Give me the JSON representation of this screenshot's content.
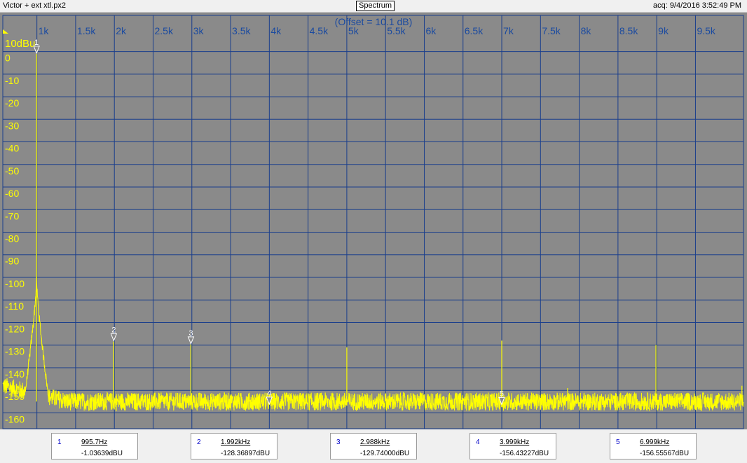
{
  "window": {
    "file_title": "Victor + ext xtl.px2",
    "view_title": "Spectrum",
    "acquired": "acq: 9/4/2016 3:52:49 PM"
  },
  "chart_data": {
    "type": "line",
    "offset_note": "(Offset = 10.1 dB)",
    "y_top_label": "10dBu",
    "xlim": [
      560,
      10120
    ],
    "ylim": [
      -167,
      16
    ],
    "x_ticks": [
      {
        "v": 1000,
        "label": "1k"
      },
      {
        "v": 1500,
        "label": "1.5k"
      },
      {
        "v": 2000,
        "label": "2k"
      },
      {
        "v": 2500,
        "label": "2.5k"
      },
      {
        "v": 3000,
        "label": "3k"
      },
      {
        "v": 3500,
        "label": "3.5k"
      },
      {
        "v": 4000,
        "label": "4k"
      },
      {
        "v": 4500,
        "label": "4.5k"
      },
      {
        "v": 5000,
        "label": "5k"
      },
      {
        "v": 5500,
        "label": "5.5k"
      },
      {
        "v": 6000,
        "label": "6k"
      },
      {
        "v": 6500,
        "label": "6.5k"
      },
      {
        "v": 7000,
        "label": "7k"
      },
      {
        "v": 7500,
        "label": "7.5k"
      },
      {
        "v": 8000,
        "label": "8k"
      },
      {
        "v": 8500,
        "label": "8.5k"
      },
      {
        "v": 9000,
        "label": "9k"
      },
      {
        "v": 9500,
        "label": "9.5k"
      }
    ],
    "y_ticks": [
      {
        "v": 0,
        "label": "0"
      },
      {
        "v": -10,
        "label": "-10"
      },
      {
        "v": -20,
        "label": "-20"
      },
      {
        "v": -30,
        "label": "-30"
      },
      {
        "v": -40,
        "label": "-40"
      },
      {
        "v": -50,
        "label": "-50"
      },
      {
        "v": -60,
        "label": "-60"
      },
      {
        "v": -70,
        "label": "-70"
      },
      {
        "v": -80,
        "label": "-80"
      },
      {
        "v": -90,
        "label": "-90"
      },
      {
        "v": -100,
        "label": "-100"
      },
      {
        "v": -110,
        "label": "-110"
      },
      {
        "v": -120,
        "label": "-120"
      },
      {
        "v": -130,
        "label": "-130"
      },
      {
        "v": -140,
        "label": "-140"
      },
      {
        "v": -150,
        "label": "-150"
      },
      {
        "v": -160,
        "label": "-160"
      }
    ],
    "noise_floor": -155,
    "noise_spread": 4,
    "series": [
      {
        "color": "#ffff00",
        "peaks": [
          {
            "x": 995.7,
            "y": -1.0
          },
          {
            "x": 1992,
            "y": -128.4
          },
          {
            "x": 2988,
            "y": -129.7
          },
          {
            "x": 3999,
            "y": -156.4
          },
          {
            "x": 5000,
            "y": -131
          },
          {
            "x": 5950,
            "y": -151
          },
          {
            "x": 6999,
            "y": -156.6
          },
          {
            "x": 7000,
            "y": -128
          },
          {
            "x": 7850,
            "y": -149
          },
          {
            "x": 8990,
            "y": -130
          },
          {
            "x": 10100,
            "y": -148
          }
        ]
      }
    ],
    "markers": [
      {
        "n": "1",
        "x": 995.7,
        "y": -1.03639,
        "freq": "995.7Hz",
        "level": "-1.03639dBU"
      },
      {
        "n": "2",
        "x": 1992,
        "y": -128.36897,
        "freq": "1.992kHz",
        "level": "-128.36897dBU"
      },
      {
        "n": "3",
        "x": 2988,
        "y": -129.74,
        "freq": "2.988kHz",
        "level": "-129.74000dBU"
      },
      {
        "n": "4",
        "x": 3999,
        "y": -156.43227,
        "freq": "3.999kHz",
        "level": "-156.43227dBU"
      },
      {
        "n": "5",
        "x": 6999,
        "y": -156.55567,
        "freq": "6.999kHz",
        "level": "-156.55567dBU"
      }
    ],
    "colors": {
      "background": "#8a8a8a",
      "grid": "#1a3e8c",
      "trace": "#ffff00",
      "axis_text": "#ffff00",
      "top_text": "#1a4aa0"
    }
  }
}
